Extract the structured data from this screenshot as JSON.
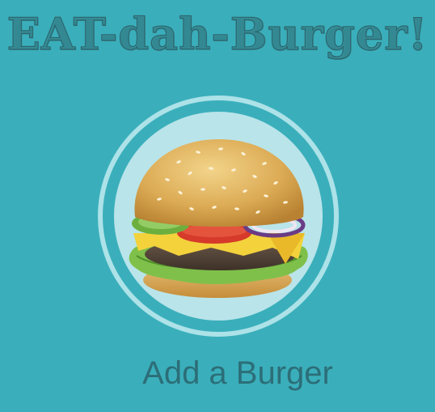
{
  "header": {
    "title": "EAT-dah-Burger!"
  },
  "burger_button": {
    "icon": "burger-icon",
    "label": "Add a Burger"
  },
  "colors": {
    "background": "#3aafbb",
    "ring": "#ace2e8",
    "label": "#2c6e78"
  }
}
